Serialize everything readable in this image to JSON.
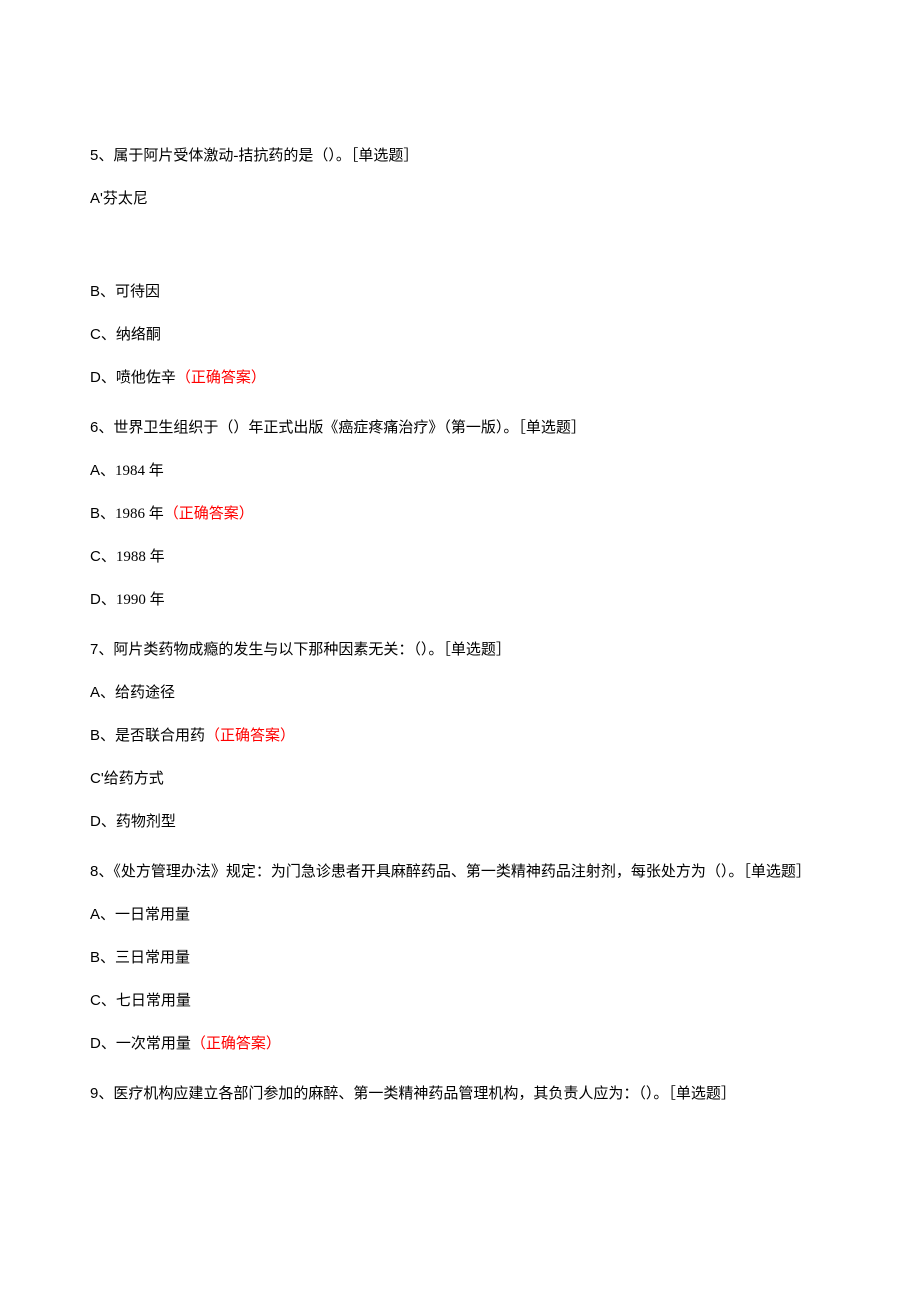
{
  "correctLabel": "（正确答案）",
  "questions": [
    {
      "number": "5",
      "stem": "属于阿片受体激动-拮抗药的是（）。［单选题］",
      "extraSpaceAfterA": true,
      "options": [
        {
          "letter": "A'",
          "text": "芬太尼",
          "correct": false
        },
        {
          "letter": "B、",
          "text": "可待因",
          "correct": false
        },
        {
          "letter": "C、",
          "text": "纳络酮",
          "correct": false
        },
        {
          "letter": "D、",
          "text": "喷他佐辛",
          "correct": true
        }
      ]
    },
    {
      "number": "6",
      "stem": "世界卫生组织于（）年正式出版《癌症疼痛治疗》（第一版）。［单选题］",
      "options": [
        {
          "letter": "A、",
          "text": "1984 年",
          "correct": false
        },
        {
          "letter": "B、",
          "text": "1986 年",
          "correct": true
        },
        {
          "letter": "C、",
          "text": "1988 年",
          "correct": false
        },
        {
          "letter": "D、",
          "text": "1990 年",
          "correct": false
        }
      ]
    },
    {
      "number": "7",
      "stem": "阿片类药物成瘾的发生与以下那种因素无关：（）。［单选题］",
      "options": [
        {
          "letter": "A、",
          "text": "给药途径",
          "correct": false
        },
        {
          "letter": "B、",
          "text": "是否联合用药",
          "correct": true
        },
        {
          "letter": "C'",
          "text": "给药方式",
          "correct": false
        },
        {
          "letter": "D、",
          "text": "药物剂型",
          "correct": false
        }
      ]
    },
    {
      "number": "8",
      "stem": "《处方管理办法》规定：为门急诊患者开具麻醉药品、第一类精神药品注射剂，每张处方为（）。［单选题］",
      "options": [
        {
          "letter": "A、",
          "text": "一日常用量",
          "correct": false
        },
        {
          "letter": "B、",
          "text": "三日常用量",
          "correct": false
        },
        {
          "letter": "C、",
          "text": "七日常用量",
          "correct": false
        },
        {
          "letter": "D、",
          "text": "一次常用量",
          "correct": true
        }
      ]
    },
    {
      "number": "9",
      "stem": "医疗机构应建立各部门参加的麻醉、第一类精神药品管理机构，其负责人应为：（）。［单选题］",
      "options": []
    }
  ]
}
